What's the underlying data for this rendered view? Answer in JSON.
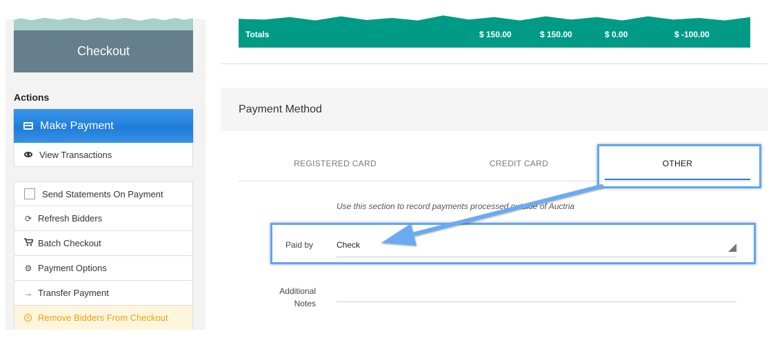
{
  "sidebar": {
    "checkout_label": "Checkout",
    "actions_heading": "Actions",
    "make_payment_label": "Make Payment",
    "view_transactions_label": "View Transactions",
    "items": [
      {
        "label": "Send Statements On Payment",
        "icon": "checkbox"
      },
      {
        "label": "Refresh Bidders",
        "icon": "refresh-icon"
      },
      {
        "label": "Batch Checkout",
        "icon": "cart-icon"
      },
      {
        "label": "Payment Options",
        "icon": "gear-icon"
      },
      {
        "label": "Transfer Payment",
        "icon": "arrow-right-icon"
      },
      {
        "label": "Remove Bidders From Checkout",
        "icon": "x-circle-icon"
      }
    ],
    "colors": {
      "primary": "#2583de",
      "checkout_bg": "#657f8c",
      "warning": "#e8a317"
    }
  },
  "totals": {
    "label": "Totals",
    "values": [
      "$ 150.00",
      "$ 150.00",
      "$ 0.00",
      "$ -100.00"
    ],
    "color": "#009b86"
  },
  "payment_method": {
    "title": "Payment Method",
    "tabs": [
      {
        "label": "REGISTERED CARD",
        "active": false
      },
      {
        "label": "CREDIT CARD",
        "active": false
      },
      {
        "label": "OTHER",
        "active": true
      }
    ],
    "info_note": "Use this section to record payments processed outside of Auctria",
    "paid_by_label": "Paid by",
    "paid_by_value": "Check",
    "notes_label": "Additional Notes"
  }
}
